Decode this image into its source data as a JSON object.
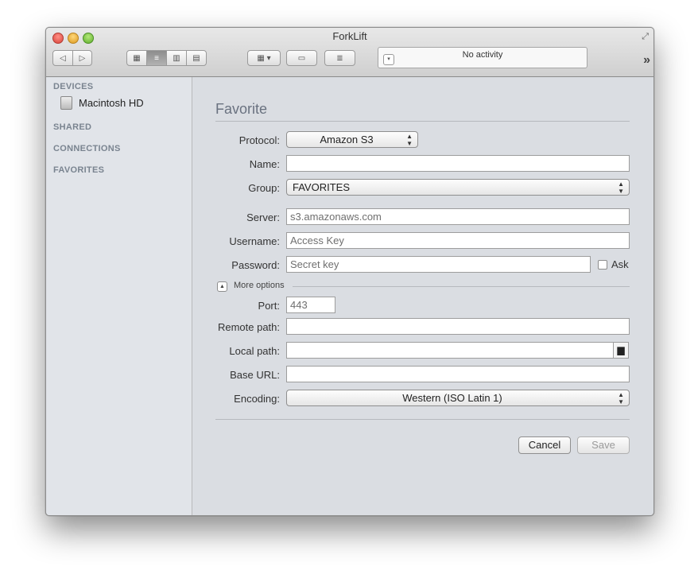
{
  "window": {
    "title": "ForkLift"
  },
  "toolbar": {
    "activity_text": "No activity"
  },
  "sidebar": {
    "sections": [
      {
        "heading": "DEVICES",
        "items": [
          {
            "label": "Macintosh HD"
          }
        ]
      },
      {
        "heading": "SHARED"
      },
      {
        "heading": "CONNECTIONS"
      },
      {
        "heading": "FAVORITES"
      }
    ]
  },
  "form": {
    "heading": "Favorite",
    "protocol": {
      "label": "Protocol:",
      "value": "Amazon S3"
    },
    "name": {
      "label": "Name:",
      "value": ""
    },
    "group": {
      "label": "Group:",
      "value": "FAVORITES"
    },
    "server": {
      "label": "Server:",
      "placeholder": "s3.amazonaws.com"
    },
    "username": {
      "label": "Username:",
      "placeholder": "Access Key"
    },
    "password": {
      "label": "Password:",
      "placeholder": "Secret key",
      "ask_label": "Ask"
    },
    "more_options_label": "More options",
    "port": {
      "label": "Port:",
      "placeholder": "443"
    },
    "remote_path": {
      "label": "Remote path:",
      "value": ""
    },
    "local_path": {
      "label": "Local path:",
      "value": ""
    },
    "base_url": {
      "label": "Base URL:",
      "value": ""
    },
    "encoding": {
      "label": "Encoding:",
      "value": "Western (ISO Latin 1)"
    },
    "cancel_label": "Cancel",
    "save_label": "Save"
  }
}
